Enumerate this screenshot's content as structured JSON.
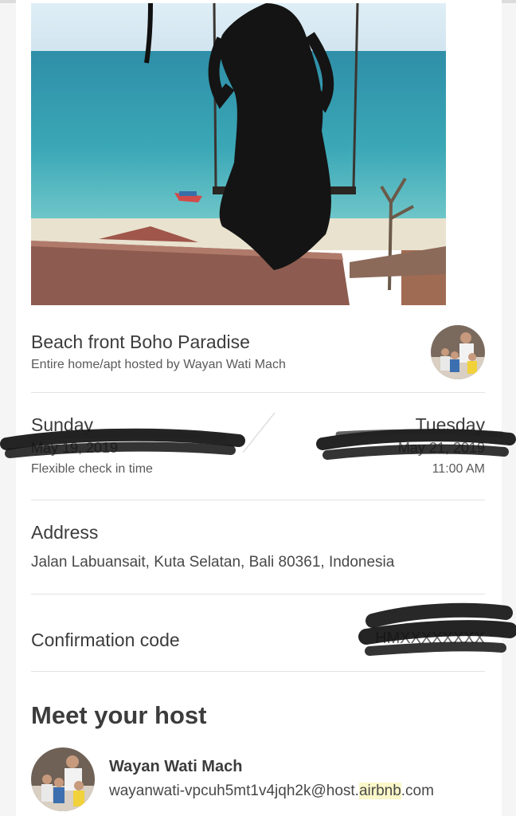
{
  "listing": {
    "title": "Beach front Boho Paradise",
    "subtitle": "Entire home/apt hosted by Wayan Wati Mach"
  },
  "dates": {
    "checkin_day": "Sunday",
    "checkin_date": "May 19, 2019",
    "checkin_note": "Flexible check in time",
    "checkout_day": "Tuesday",
    "checkout_date": "May 21, 2019",
    "checkout_time": "11:00 AM"
  },
  "address": {
    "label": "Address",
    "value": "Jalan Labuansait, Kuta Selatan, Bali 80361, Indonesia"
  },
  "confirmation": {
    "label": "Confirmation code",
    "value": "HMXXXXXXXX"
  },
  "host": {
    "section_title": "Meet your host",
    "name": "Wayan Wati Mach",
    "email_prefix": "wayanwati-vpcuh5mt1v4jqh2k@host.",
    "email_highlight": "airbnb",
    "email_suffix": ".com"
  },
  "colors": {
    "page_bg": "#f5f5f5",
    "card_bg": "#ffffff",
    "text": "#484848",
    "highlight": "#fbf7c8",
    "redaction": "#111111"
  }
}
